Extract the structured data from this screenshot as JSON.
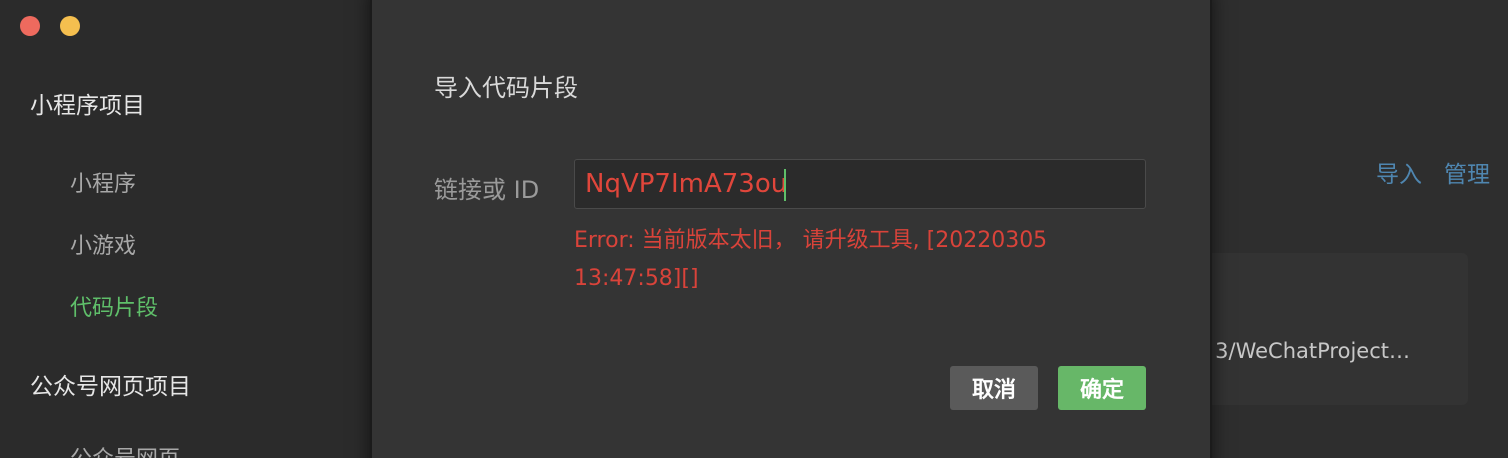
{
  "window": {
    "controls": [
      "close",
      "minimize"
    ]
  },
  "sidebar": {
    "sections": [
      {
        "title": "小程序项目",
        "items": [
          {
            "label": "小程序",
            "active": false
          },
          {
            "label": "小游戏",
            "active": false
          },
          {
            "label": "代码片段",
            "active": true
          }
        ]
      },
      {
        "title": "公众号网页项目",
        "items": [
          {
            "label": "公众号网页",
            "active": false
          }
        ]
      }
    ]
  },
  "content": {
    "links": {
      "import": "导入",
      "manage": "管理"
    },
    "card_path": "3/WeChatProject…"
  },
  "modal": {
    "title": "导入代码片段",
    "field_label": "链接或 ID",
    "field_value": "NqVP7ImA73ou",
    "error_line1": "Error: 当前版本太旧， 请升级工具, [20220305",
    "error_line2": "13:47:58][]",
    "cancel_label": "取消",
    "ok_label": "确定"
  },
  "colors": {
    "accent_green": "#5fbf6a",
    "error_red": "#d9433a",
    "link_blue": "#4f86b0",
    "ok_button": "#67b768",
    "cancel_button": "#5a5a5a"
  }
}
